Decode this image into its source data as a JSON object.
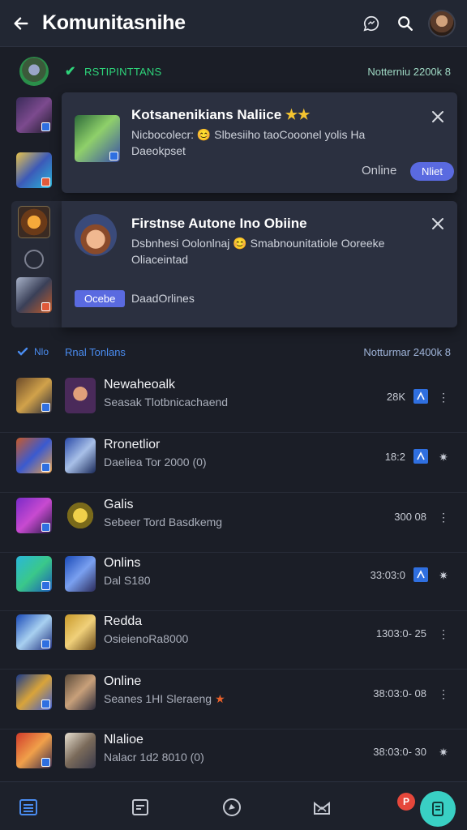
{
  "app": {
    "title": "Komunitasnihe"
  },
  "section1": {
    "title": "RSTIPINTTANS",
    "meta": "Notterniu 2200k 8"
  },
  "notification1": {
    "title": "Kotsanenikians Naliice",
    "stars": "★★",
    "line1_prefix": "Nicbocolecr:",
    "emoji": "😊",
    "line1_suffix": "Slbesiiho taoCooonel yolis Ha",
    "line2": "Daeokpset",
    "status": "Online",
    "pill": "Nliet"
  },
  "notification2": {
    "title": "Firstnse Autone Ino Obiine",
    "line1_prefix": "Dsbnhesi Oolonlnaj",
    "emoji": "😊",
    "line1_suffix": "Smabnounitatiole Ooreeke",
    "line2": "Oliaceintad",
    "button": "Ocebe",
    "status": "DaadOrlines"
  },
  "section2": {
    "check_label": "Nlo",
    "title": "Rnal Tonlans",
    "meta": "Notturmar 2400k 8"
  },
  "rows": [
    {
      "title": "Newaheoalk",
      "sub": "Seasak Tlotbnicachaend",
      "meta": "28K",
      "chip": true,
      "more": "⋮"
    },
    {
      "title": "Rronetlior",
      "sub": "Daeliea Tor 2000 (0)",
      "meta": "18:2",
      "chip": true,
      "more": "✷"
    },
    {
      "title": "Galis",
      "sub": "Sebeer Tord Basdkemg",
      "meta": "300 08",
      "chip": false,
      "more": "⋮"
    },
    {
      "title": "Onlins",
      "sub": "Dal S180",
      "meta": "33:03:0",
      "chip": true,
      "more": "✷"
    },
    {
      "title": "Redda",
      "sub": "OsieienoRa8000",
      "meta": "1303:0- 25",
      "chip": false,
      "more": "⋮"
    },
    {
      "title": "Online",
      "sub": "Seanes 1HI Sleraeng",
      "star": "★",
      "meta": "38:03:0- 08",
      "chip": false,
      "more": "⋮"
    },
    {
      "title": "Nlalioe",
      "sub": "Nalacr 1d2 8010 (0)",
      "meta": "38:03:0- 30",
      "chip": false,
      "more": "✷"
    }
  ],
  "badge": {
    "count": "P"
  },
  "colors": {
    "accent_green": "#2ed47a",
    "accent_blue": "#5a6ae0",
    "fab": "#39d0c4"
  }
}
